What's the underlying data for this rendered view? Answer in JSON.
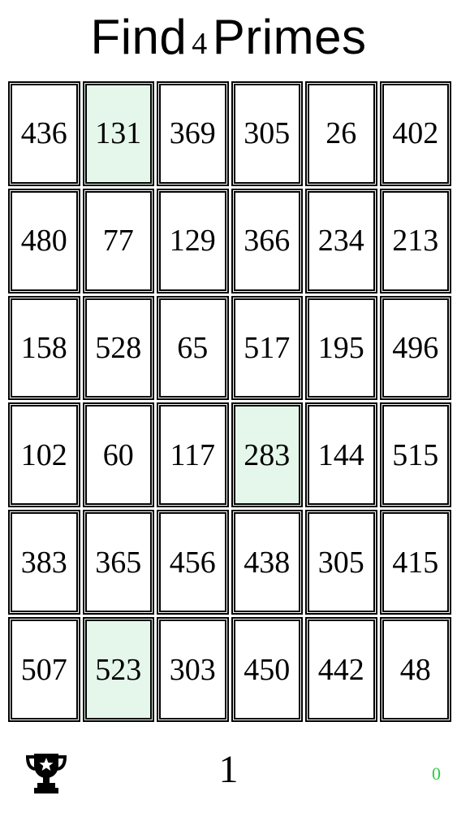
{
  "header": {
    "prefix": "Find",
    "count": "4",
    "suffix": "Primes"
  },
  "grid": {
    "cells": [
      {
        "value": "436",
        "found": false
      },
      {
        "value": "131",
        "found": true
      },
      {
        "value": "369",
        "found": false
      },
      {
        "value": "305",
        "found": false
      },
      {
        "value": "26",
        "found": false
      },
      {
        "value": "402",
        "found": false
      },
      {
        "value": "480",
        "found": false
      },
      {
        "value": "77",
        "found": false
      },
      {
        "value": "129",
        "found": false
      },
      {
        "value": "366",
        "found": false
      },
      {
        "value": "234",
        "found": false
      },
      {
        "value": "213",
        "found": false
      },
      {
        "value": "158",
        "found": false
      },
      {
        "value": "528",
        "found": false
      },
      {
        "value": "65",
        "found": false
      },
      {
        "value": "517",
        "found": false
      },
      {
        "value": "195",
        "found": false
      },
      {
        "value": "496",
        "found": false
      },
      {
        "value": "102",
        "found": false
      },
      {
        "value": "60",
        "found": false
      },
      {
        "value": "117",
        "found": false
      },
      {
        "value": "283",
        "found": true
      },
      {
        "value": "144",
        "found": false
      },
      {
        "value": "515",
        "found": false
      },
      {
        "value": "383",
        "found": false
      },
      {
        "value": "365",
        "found": false
      },
      {
        "value": "456",
        "found": false
      },
      {
        "value": "438",
        "found": false
      },
      {
        "value": "305",
        "found": false
      },
      {
        "value": "415",
        "found": false
      },
      {
        "value": "507",
        "found": false
      },
      {
        "value": "523",
        "found": true
      },
      {
        "value": "303",
        "found": false
      },
      {
        "value": "450",
        "found": false
      },
      {
        "value": "442",
        "found": false
      },
      {
        "value": "48",
        "found": false
      }
    ]
  },
  "footer": {
    "trophy_icon": "trophy-icon",
    "level": "1",
    "score": "0",
    "score_color": "#2ecc40"
  },
  "colors": {
    "found_cell": "#e4f7ea",
    "border": "#000000"
  }
}
